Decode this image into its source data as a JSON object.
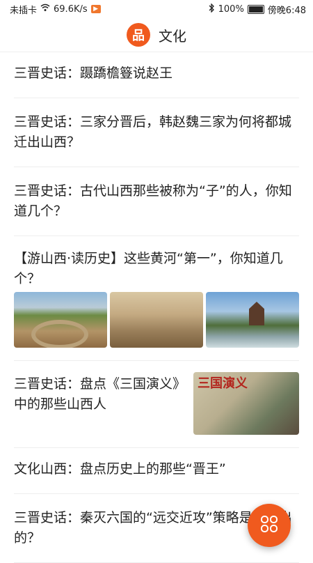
{
  "status_bar": {
    "carrier": "未插卡",
    "speed": "69.6K/s",
    "battery": "100%",
    "time": "傍晚6:48"
  },
  "header": {
    "title": "文化",
    "logo_char": "品"
  },
  "articles": [
    {
      "title": "三晋史话：蹑蹻檐簦说赵王"
    },
    {
      "title": "三晋史话：三家分晋后，韩赵魏三家为何将都城迁出山西？"
    },
    {
      "title": "三晋史话：古代山西那些被称为“子”的人，你知道几个？"
    },
    {
      "title": "【游山西·读历史】这些黄河“第一”，你知道几个？"
    },
    {
      "title": "三晋史话：盘点《三国演义》中的那些山西人",
      "thumb_text": "三国演义"
    },
    {
      "title": "文化山西：盘点历史上的那些“晋王”"
    },
    {
      "title": "三晋史话：秦灭六国的“远交近攻”策略是谁提出的？"
    }
  ],
  "colors": {
    "accent": "#f05a1e"
  }
}
